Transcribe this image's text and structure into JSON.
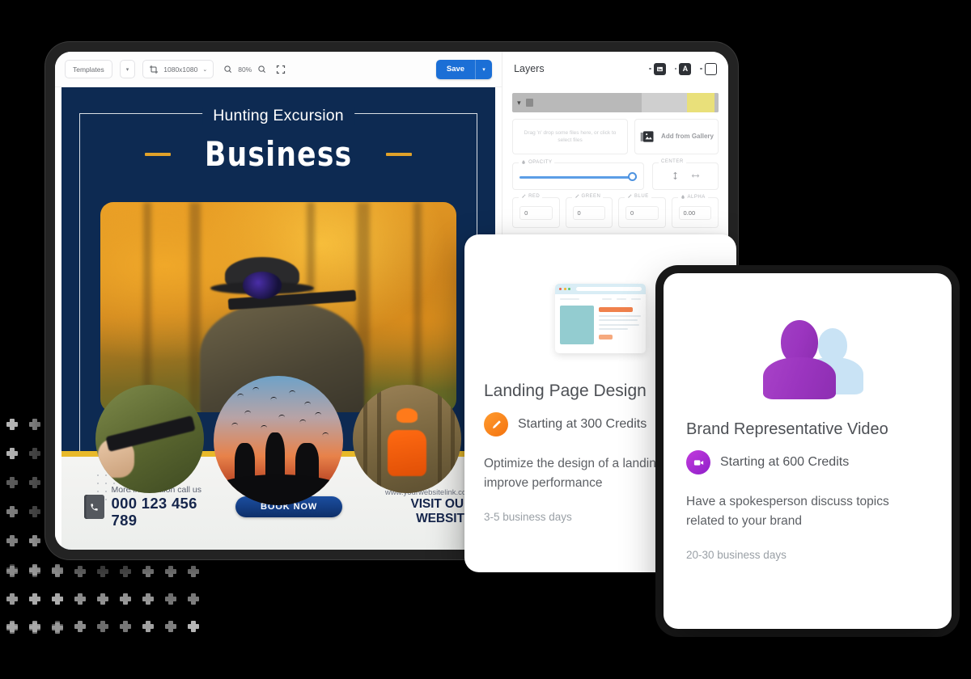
{
  "editor": {
    "toolbar": {
      "templates_label": "Templates",
      "templates_caret": "▾",
      "crop_icon": "crop-icon",
      "size_label": "1080x1080",
      "size_caret": "⌄",
      "zoom_out_icon": "zoom-out-icon",
      "zoom_level": "80%",
      "zoom_in_icon": "zoom-in-icon",
      "fullscreen_icon": "fullscreen-icon",
      "save_label": "Save",
      "save_caret": "▾"
    },
    "poster": {
      "kicker": "Hunting Excursion",
      "headline": "Business",
      "phone_caption": "More information call us",
      "phone_number": "000 123 456 789",
      "cta_button": "BOOK NOW",
      "website_url": "www.yourwebsitelink.com",
      "website_cta": "VISIT OUR WEBSITE",
      "hero_alt": "hunter aiming rifle in autumn forest",
      "circle_1_alt": "close-up of scoped rifle being held",
      "circle_2_alt": "silhouette of hunters at sunset with birds",
      "circle_3_alt": "hunter in orange vest in cornfield"
    },
    "layers": {
      "title": "Layers",
      "tool_image_icon": "image-layer-icon",
      "tool_text_icon": "text-layer-icon",
      "tool_shape_icon": "shape-layer-icon",
      "layer_row_chevron": "▾",
      "dropzone_text": "Drag 'n' drop some files here, or click to select files",
      "gallery_label": "Add from Gallery",
      "gallery_icon": "gallery-icon",
      "opacity_legend": "OPACITY",
      "opacity_icon": "droplet-icon",
      "center_legend": "CENTER",
      "center_vertical_icon": "align-vertical-icon",
      "center_horizontal_icon": "align-horizontal-icon",
      "fields": [
        {
          "legend": "RED",
          "icon": "eyedropper-icon",
          "value": "0"
        },
        {
          "legend": "GREEN",
          "icon": "eyedropper-icon",
          "value": "0"
        },
        {
          "legend": "BLUE",
          "icon": "eyedropper-icon",
          "value": "0"
        },
        {
          "legend": "ALPHA",
          "icon": "droplet-icon",
          "value": "0.00"
        }
      ]
    }
  },
  "cards": [
    {
      "id": "landing-page-design",
      "art": "browser-window-illustration",
      "title": "Landing Page Design",
      "badge_icon": "pencil-icon",
      "price": "Starting at 300 Credits",
      "description": "Optimize the design of a landing page to improve performance",
      "turnaround": "3-5 business days"
    },
    {
      "id": "brand-representative-video",
      "art": "two-people-illustration",
      "title": "Brand Representative Video",
      "badge_icon": "video-camera-icon",
      "price": "Starting at 600 Credits",
      "description": "Have a spokesperson discuss topics related to your brand",
      "turnaround": "20-30 business days"
    }
  ],
  "colors": {
    "background": "#000000",
    "save_blue": "#1b6fd6",
    "poster_navy": "#0d2a52",
    "poster_gold": "#e8b929",
    "landing_accent": "#f4730f",
    "brand_accent": "#9b35bf"
  }
}
